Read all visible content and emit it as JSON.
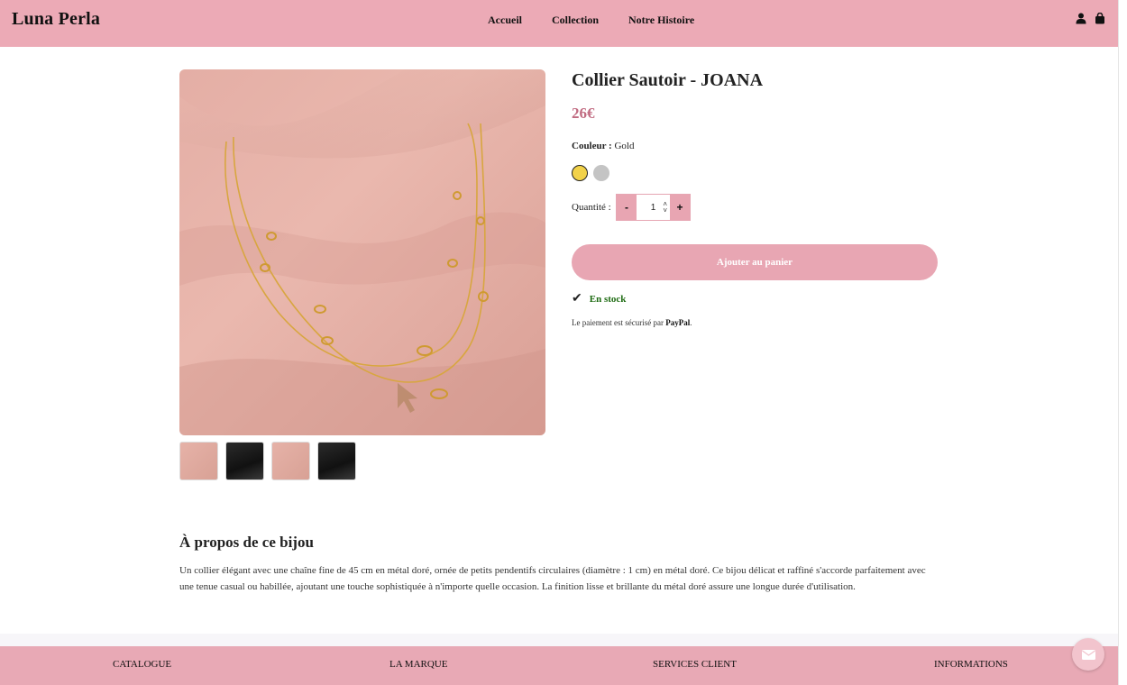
{
  "brand": {
    "logo": "Luna Perla",
    "accent": "#ecaab6",
    "price_color": "#c06a80",
    "stock_color": "#1e6b12"
  },
  "nav": {
    "items": [
      "Accueil",
      "Collection",
      "Notre Histoire"
    ]
  },
  "header_icons": [
    "user-icon",
    "shopping-bag-icon"
  ],
  "product": {
    "title": "Collier Sautoir - JOANA",
    "price": "26€",
    "color_label": "Couleur :",
    "color_value": "Gold",
    "swatches": [
      {
        "name": "Gold",
        "hex": "#f2d24a",
        "selected": true
      },
      {
        "name": "Silver",
        "hex": "#c4c4c4",
        "selected": false
      }
    ],
    "quantity_label": "Quantité :",
    "quantity_minus": "-",
    "quantity_value": "1",
    "quantity_plus": "+",
    "add_to_cart": "Ajouter au panier",
    "stock": "En stock",
    "secure_prefix": "Le paiement est sécurisé par",
    "secure_provider": "PayPal",
    "secure_suffix": "."
  },
  "gallery": {
    "thumbnails": [
      "pink",
      "dark",
      "pink",
      "dark"
    ]
  },
  "about": {
    "title": "À propos de ce bijou",
    "text": "Un collier élégant avec une chaîne fine de 45 cm en métal doré, ornée de petits pendentifs circulaires (diamètre : 1 cm) en métal doré. Ce bijou délicat et raffiné s'accorde parfaitement avec une tenue casual ou habillée, ajoutant une touche sophistiquée à n'importe quelle occasion. La finition lisse et brillante du métal doré assure une longue durée d'utilisation."
  },
  "footer": {
    "columns": [
      "CATALOGUE",
      "LA MARQUE",
      "SERVICES CLIENT",
      "INFORMATIONS"
    ]
  },
  "chat": {
    "icon": "envelope-icon"
  }
}
